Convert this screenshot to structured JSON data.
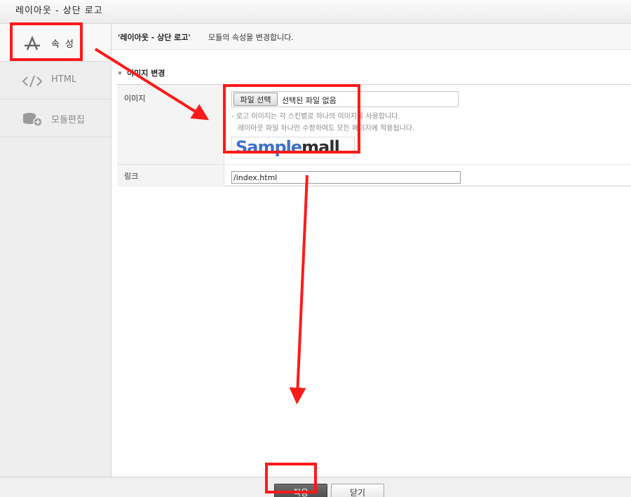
{
  "window": {
    "title": "레이아웃 - 상단 로고"
  },
  "sidebar": {
    "items": [
      {
        "label": "속성",
        "icon": "app-store-icon",
        "active": true
      },
      {
        "label": "HTML",
        "icon": "code-icon",
        "active": false
      },
      {
        "label": "모듈편집",
        "icon": "module-add-icon",
        "active": false
      }
    ]
  },
  "notice": {
    "module_name": "'레이아웃 - 상단 로고'",
    "text": "모듈의 속성을 변경합니다."
  },
  "section": {
    "title": "이미지 변경"
  },
  "form": {
    "image": {
      "label": "이미지",
      "file_button": "파일 선택",
      "file_status": "선택된 파일 없음",
      "help_lines": [
        "- 로고 이미지는 각 스킨별로 하나의 이미지를 사용합니다.",
        "레이아웃 파일 하나만 수정하여도 모든 페이지에 적용됩니다."
      ],
      "logo_text_blue": "Sample",
      "logo_text_dark": "mall"
    },
    "link": {
      "label": "링크",
      "value": "/index.html"
    }
  },
  "footer": {
    "apply_label": "적용",
    "close_label": "닫기"
  },
  "colors": {
    "annotation_red": "#ff1a1a",
    "logo_blue": "#3f6fc8",
    "apply_button": "#555555"
  }
}
